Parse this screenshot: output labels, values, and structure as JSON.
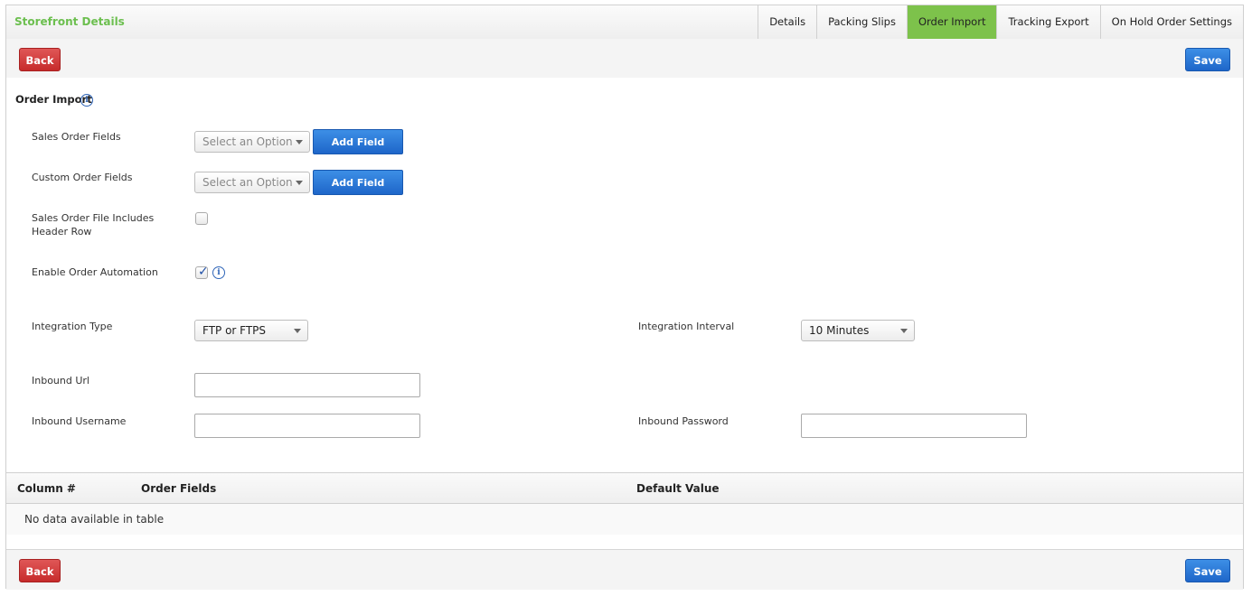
{
  "header": {
    "title": "Storefront Details",
    "tabs": [
      {
        "label": "Details",
        "active": false
      },
      {
        "label": "Packing Slips",
        "active": false
      },
      {
        "label": "Order Import",
        "active": true
      },
      {
        "label": "Tracking Export",
        "active": false
      },
      {
        "label": "On Hold Order Settings",
        "active": false
      }
    ]
  },
  "toolbar": {
    "back_label": "Back",
    "save_label": "Save"
  },
  "section": {
    "title": "Order Import",
    "info_icon": "info-icon"
  },
  "form": {
    "sales_order_fields": {
      "label": "Sales Order Fields",
      "placeholder": "Select an Option",
      "button": "Add Field"
    },
    "custom_order_fields": {
      "label": "Custom Order Fields",
      "placeholder": "Select an Option",
      "button": "Add Field"
    },
    "header_row": {
      "label_line1": "Sales Order File Includes",
      "label_line2": "Header Row",
      "checked": false
    },
    "automation": {
      "label": "Enable Order Automation",
      "checked": true
    },
    "integration_type": {
      "label": "Integration Type",
      "value": "FTP or FTPS"
    },
    "integration_interval": {
      "label": "Integration Interval",
      "value": "10 Minutes"
    },
    "inbound_url": {
      "label": "Inbound Url",
      "value": ""
    },
    "inbound_username": {
      "label": "Inbound Username",
      "value": ""
    },
    "inbound_password": {
      "label": "Inbound Password",
      "value": ""
    }
  },
  "table": {
    "columns": [
      "Column #",
      "Order Fields",
      "Default Value"
    ],
    "empty_message": "No data available in table"
  },
  "colors": {
    "title_green": "#6cbf4f",
    "active_tab": "#7dc24b",
    "back_red": "#c62b2b",
    "save_blue": "#1e66c9"
  }
}
